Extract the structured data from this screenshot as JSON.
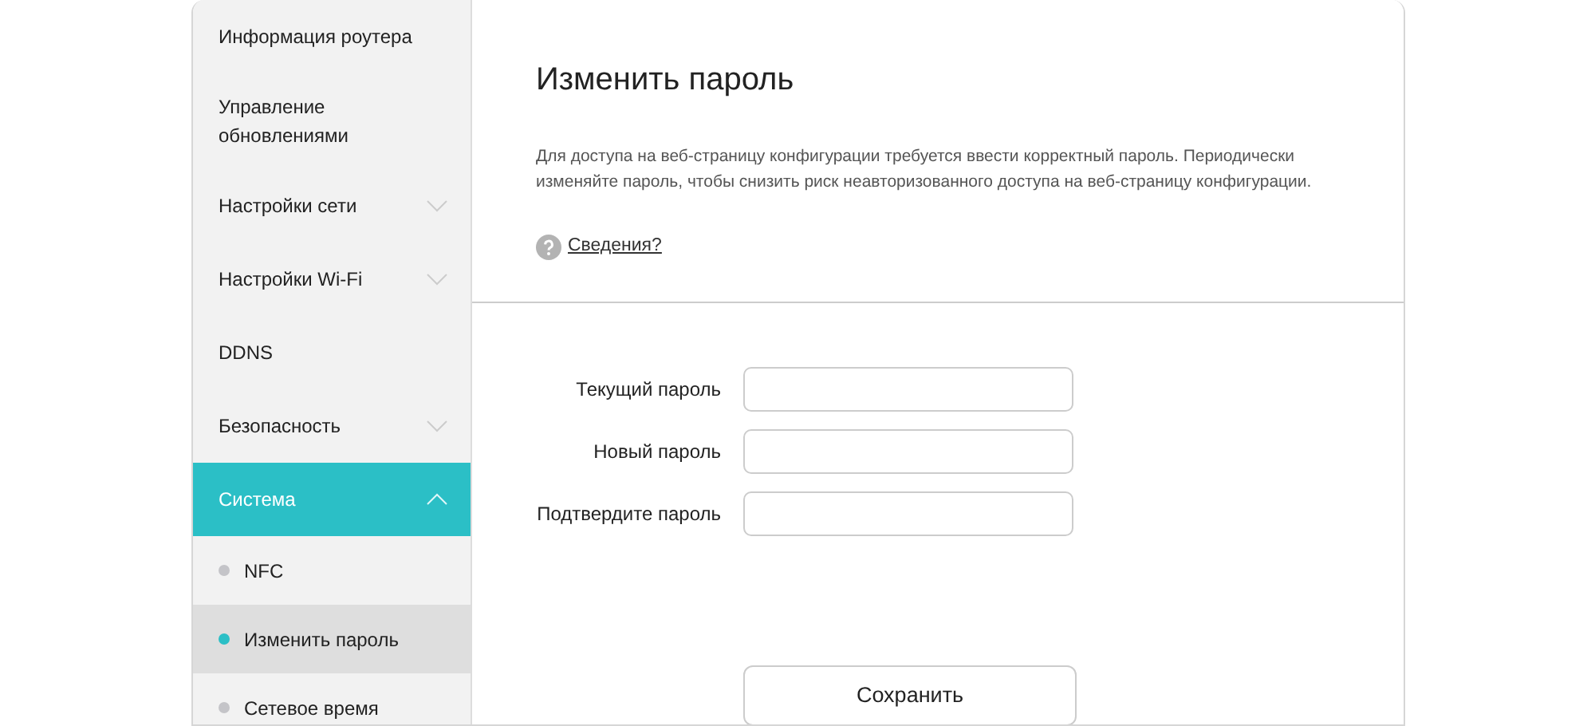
{
  "sidebar": {
    "items": [
      {
        "label": "Информация роутера",
        "selected": false
      },
      {
        "label": "Управление обновлениями",
        "selected": false
      },
      {
        "label": "Настройки сети",
        "selected": false,
        "expanded": false
      },
      {
        "label": "Настройки Wi-Fi",
        "selected": false,
        "expanded": false
      },
      {
        "label": "DDNS",
        "selected": false
      },
      {
        "label": "Безопасность",
        "selected": false,
        "expanded": false
      },
      {
        "label": "Система",
        "selected": true,
        "expanded": true,
        "children": [
          {
            "label": "NFC",
            "selected": false
          },
          {
            "label": "Изменить пароль",
            "selected": true
          },
          {
            "label": "Сетевое время",
            "selected": false
          }
        ]
      }
    ]
  },
  "header": {
    "title": "Изменить пароль",
    "description": "Для доступа на веб-страницу конфигурации требуется ввести корректный пароль. Периодически изменяйте пароль, чтобы снизить риск неавторизованного доступа на веб-страницу конфигурации.",
    "help_link": "Сведения?"
  },
  "form": {
    "fields": [
      {
        "label": "Текущий пароль"
      },
      {
        "label": "Новый пароль"
      },
      {
        "label": "Подтвердите пароль"
      }
    ],
    "save_button": "Сохранить"
  }
}
